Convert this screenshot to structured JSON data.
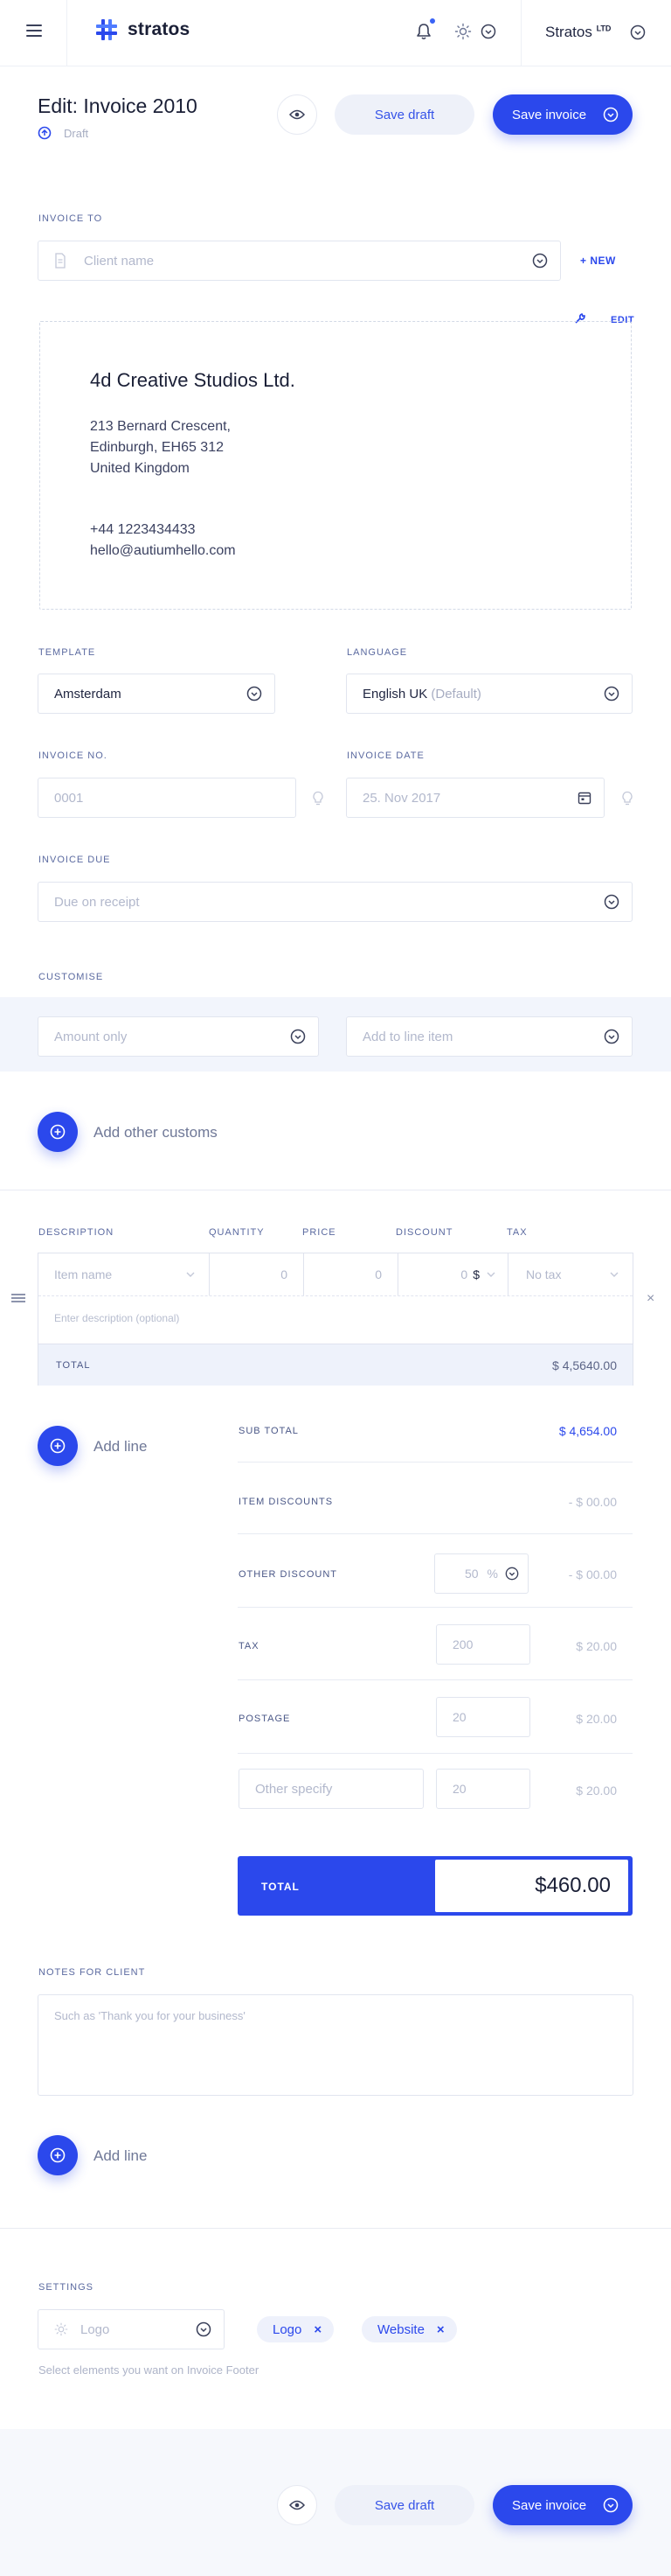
{
  "topbar": {
    "brand": "stratos",
    "company_name": "Stratos",
    "company_suffix": "LTD"
  },
  "page": {
    "title": "Edit: Invoice 2010",
    "status": "Draft",
    "save_draft_label": "Save draft",
    "save_invoice_label": "Save invoice"
  },
  "invoice_to": {
    "label": "INVOICE TO",
    "client_placeholder": "Client name",
    "new_label": "+ NEW",
    "edit_label": "EDIT",
    "client": {
      "name": "4d Creative Studios Ltd.",
      "address_line1": "213 Bernard Crescent,",
      "address_line2": "Edinburgh, EH65 312",
      "address_line3": "United Kingdom",
      "phone": "+44 1223434433",
      "email": "hello@autiumhello.com"
    }
  },
  "settings_fields": {
    "template_label": "TEMPLATE",
    "template_value": "Amsterdam",
    "language_label": "LANGUAGE",
    "language_value": "English UK",
    "language_default": "(Default)",
    "invoice_no_label": "INVOICE NO.",
    "invoice_no_placeholder": "0001",
    "invoice_date_label": "INVOICE DATE",
    "invoice_date_value": "25. Nov 2017",
    "invoice_due_label": "INVOICE DUE",
    "invoice_due_placeholder": "Due on receipt"
  },
  "customise": {
    "label": "CUSTOMISE",
    "field1_placeholder": "Amount only",
    "field2_placeholder": "Add to line item",
    "add_other_label": "Add other customs"
  },
  "lines": {
    "columns": [
      "DESCRIPTION",
      "QUANTITY",
      "PRICE",
      "DISCOUNT",
      "TAX"
    ],
    "item_name_placeholder": "Item name",
    "quantity": "0",
    "price": "0",
    "discount": "0",
    "discount_unit": "$",
    "tax_placeholder": "No tax",
    "description_placeholder": "Enter description (optional)",
    "total_label": "TOTAL",
    "total_value": "$ 4,5640.00",
    "add_line_label": "Add line"
  },
  "summary": {
    "subtotal_label": "SUB TOTAL",
    "subtotal_value": "$ 4,654.00",
    "item_discounts_label": "ITEM DISCOUNTS",
    "item_discounts_value": "- $ 00.00",
    "other_discount_label": "OTHER DISCOUNT",
    "other_discount_input": "50",
    "other_discount_unit": "%",
    "other_discount_value": "- $ 00.00",
    "tax_label": "TAX",
    "tax_input": "200",
    "tax_value": "$ 20.00",
    "postage_label": "POSTAGE",
    "postage_input": "20",
    "postage_value": "$ 20.00",
    "other_placeholder": "Other specify",
    "other_input": "20",
    "other_value": "$ 20.00",
    "total_label": "TOTAL",
    "total_value": "$460.00"
  },
  "notes": {
    "label": "NOTES FOR CLIENT",
    "placeholder": "Such as 'Thank you for your business'",
    "add_line_label": "Add line"
  },
  "footer_settings": {
    "label": "SETTINGS",
    "select_placeholder": "Logo",
    "tags": [
      "Logo",
      "Website"
    ],
    "hint": "Select elements you want on Invoice Footer"
  },
  "colors": {
    "accent": "#2b48ec",
    "band": "#f2f5fc"
  }
}
